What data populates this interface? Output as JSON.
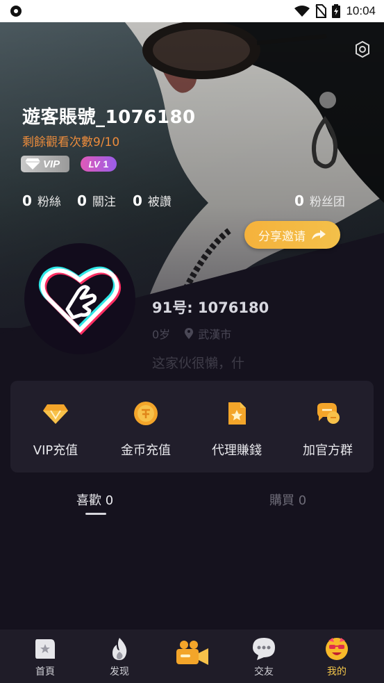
{
  "status_bar": {
    "time": "10:04"
  },
  "profile": {
    "username": "遊客賬號_1076180",
    "remaining_views": "剩餘觀看次數9/10",
    "vip_badge": "VIP",
    "level_badge": {
      "mark": "LV",
      "value": "1"
    },
    "stats": [
      {
        "count": "0",
        "label": "粉絲"
      },
      {
        "count": "0",
        "label": "關注"
      },
      {
        "count": "0",
        "label": "被讚"
      },
      {
        "count": "0",
        "label": "粉丝团"
      }
    ],
    "share_label": "分享邀请",
    "uid": "91号: 1076180",
    "age": "0岁",
    "city": "武漢市",
    "bio": "这家伙很懶，什"
  },
  "quick_actions": [
    {
      "label": "VIP充值",
      "icon": "diamond-icon"
    },
    {
      "label": "金币充值",
      "icon": "coin-icon"
    },
    {
      "label": "代理賺錢",
      "icon": "agent-star-icon"
    },
    {
      "label": "加官方群",
      "icon": "chat-group-icon"
    }
  ],
  "tabs": [
    {
      "label": "喜歡 0",
      "active": true
    },
    {
      "label": "購買 0",
      "active": false
    }
  ],
  "bottom_nav": [
    {
      "label": "首頁",
      "icon": "home-icon",
      "active": false
    },
    {
      "label": "发现",
      "icon": "flame-icon",
      "active": false
    },
    {
      "label": "",
      "icon": "camera-icon",
      "active": false
    },
    {
      "label": "交友",
      "icon": "chat-bubble-icon",
      "active": false
    },
    {
      "label": "我的",
      "icon": "smiley-icon",
      "active": true
    }
  ],
  "colors": {
    "accent_gold": "#f5b23c",
    "remaining_orange": "#ec8c3c",
    "background": "#15121e",
    "panel": "#211e2b"
  }
}
